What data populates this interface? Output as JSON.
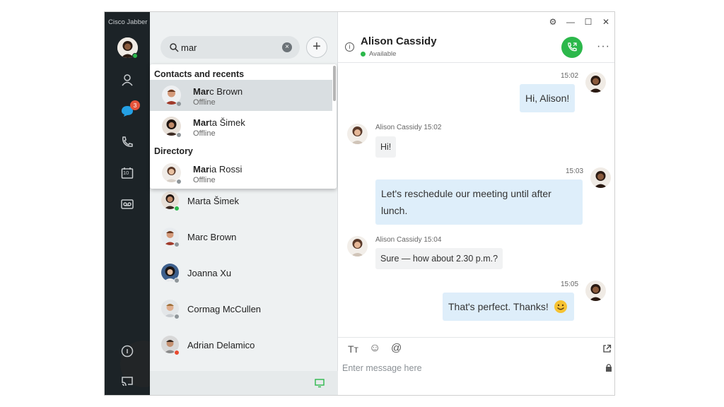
{
  "app": {
    "title": "Cisco Jabber"
  },
  "sidebar": {
    "badge_count": "3",
    "calendar_day": "10"
  },
  "search": {
    "value": "mar"
  },
  "dropdown": {
    "section_contacts": "Contacts and recents",
    "section_directory": "Directory",
    "items": [
      {
        "bold": "Mar",
        "rest": "c Brown",
        "status": "Offline"
      },
      {
        "bold": "Mar",
        "rest": "ta Šimek",
        "status": "Offline"
      },
      {
        "bold": "Mar",
        "rest": "ia Rossi",
        "status": "Offline"
      }
    ]
  },
  "contacts": [
    {
      "name": "Marta Šimek",
      "status": "available"
    },
    {
      "name": "Marc Brown",
      "status": "offline"
    },
    {
      "name": "Joanna Xu",
      "status": "offline"
    },
    {
      "name": "Cormag McCullen",
      "status": "offline"
    },
    {
      "name": "Adrian Delamico",
      "status": "busy"
    }
  ],
  "chat": {
    "contact_name": "Alison Cassidy",
    "contact_status": "Available",
    "messages": [
      {
        "dir": "out",
        "time": "15:02",
        "text": "Hi, Alison!"
      },
      {
        "dir": "in",
        "sender": "Alison Cassidy",
        "time": "15:02",
        "text": "Hi!"
      },
      {
        "dir": "out",
        "time": "15:03",
        "line1": "Let's reschedule our meeting until after",
        "line2": "lunch."
      },
      {
        "dir": "in",
        "sender": "Alison Cassidy",
        "time": "15:04",
        "text": "Sure — how about 2.30 p.m.?"
      },
      {
        "dir": "out",
        "time": "15:05",
        "text": "That's perfect. Thanks!"
      }
    ],
    "composer_placeholder": "Enter message here",
    "composer_tools": {
      "text_format": "Tт",
      "emoji": "☺",
      "mention": "@"
    }
  },
  "colors": {
    "sidebar": "#1c2327",
    "accent_green": "#2cb84b",
    "outgoing_bubble": "#deeefa",
    "badge": "#e5533a"
  },
  "icons": [
    "contacts-icon",
    "chat-icon",
    "phone-icon",
    "calendar-icon",
    "voicemail-icon",
    "help-icon",
    "screen-share-icon",
    "search-icon",
    "clear-icon",
    "add-icon",
    "gear-icon",
    "minimize-icon",
    "maximize-icon",
    "close-icon",
    "info-icon",
    "call-icon",
    "more-icon",
    "emoji-icon",
    "popout-icon",
    "lock-icon"
  ]
}
